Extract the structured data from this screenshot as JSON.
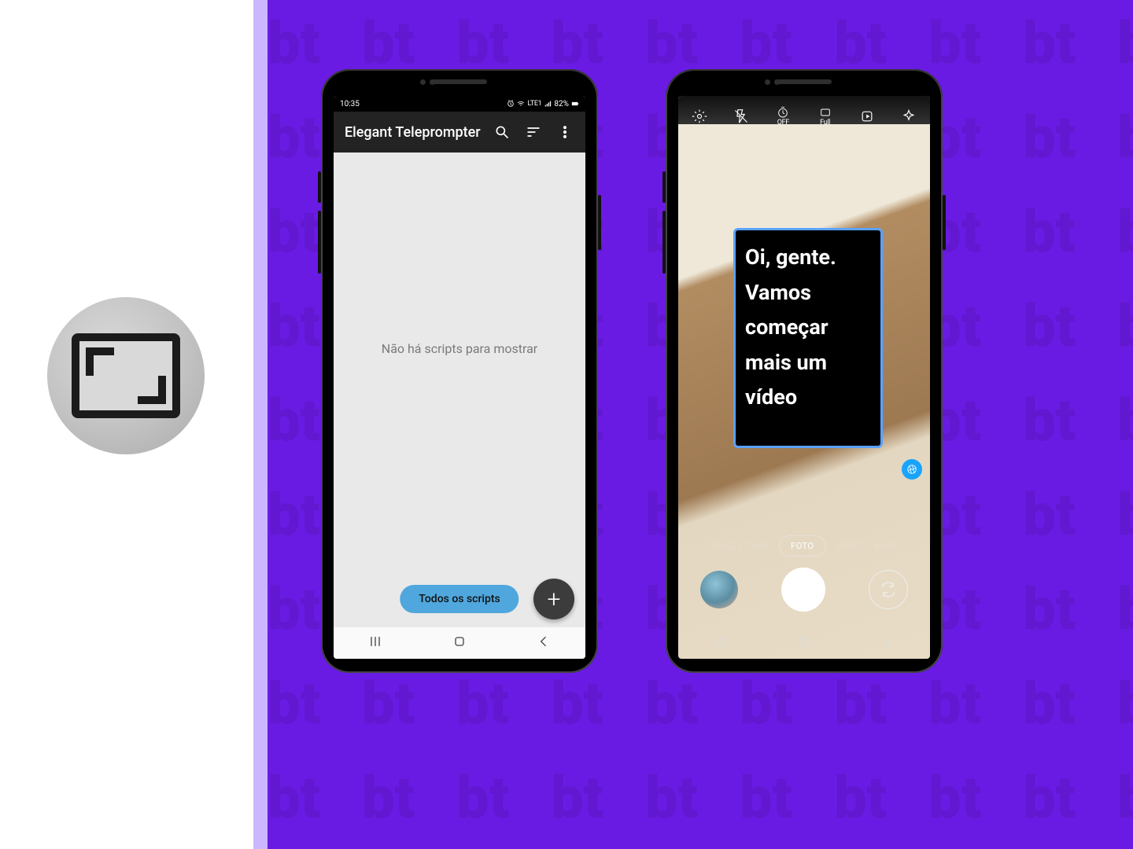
{
  "left": {
    "icon_name": "aspect-ratio-icon"
  },
  "phone1": {
    "status": {
      "time": "10:35",
      "battery": "82%",
      "network_mini": "LTE1"
    },
    "appbar": {
      "title": "Elegant Teleprompter"
    },
    "body": {
      "empty_message": "Não há scripts para mostrar",
      "chip_label": "Todos os scripts",
      "fab_label": "+"
    }
  },
  "phone2": {
    "camera_icons": [
      "settings",
      "flash-off",
      "timer-off",
      "ratio-full",
      "motion-photo",
      "effects"
    ],
    "timer_sub": "OFF",
    "ratio_sub": "Full",
    "overlay_text": "Oi, gente. Vamos começar mais um vídeo",
    "modes": {
      "items": [
        "SINGLE TAKE",
        "FOTO",
        "VÍDEO",
        "MAIS"
      ],
      "active": "FOTO"
    }
  },
  "colors": {
    "purple": "#6a1be3",
    "lilac": "#cbb7ff",
    "chip": "#4fa7dd",
    "overlay_border": "#5aa2ff"
  }
}
